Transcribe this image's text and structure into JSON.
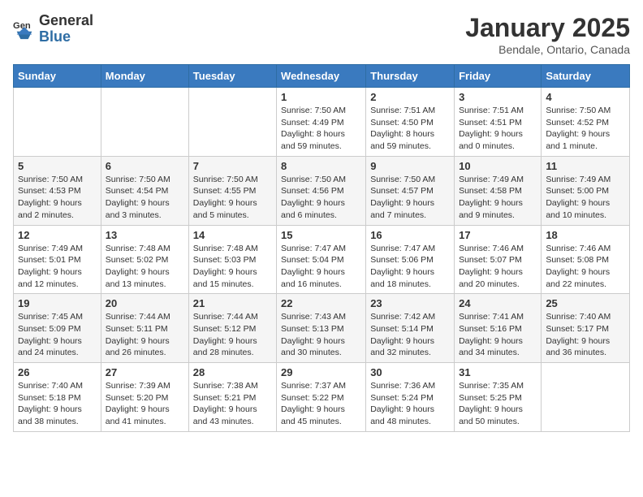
{
  "header": {
    "logo_general": "General",
    "logo_blue": "Blue",
    "month_title": "January 2025",
    "location": "Bendale, Ontario, Canada"
  },
  "weekdays": [
    "Sunday",
    "Monday",
    "Tuesday",
    "Wednesday",
    "Thursday",
    "Friday",
    "Saturday"
  ],
  "weeks": [
    [
      {
        "day": "",
        "info": ""
      },
      {
        "day": "",
        "info": ""
      },
      {
        "day": "",
        "info": ""
      },
      {
        "day": "1",
        "info": "Sunrise: 7:50 AM\nSunset: 4:49 PM\nDaylight: 8 hours\nand 59 minutes."
      },
      {
        "day": "2",
        "info": "Sunrise: 7:51 AM\nSunset: 4:50 PM\nDaylight: 8 hours\nand 59 minutes."
      },
      {
        "day": "3",
        "info": "Sunrise: 7:51 AM\nSunset: 4:51 PM\nDaylight: 9 hours\nand 0 minutes."
      },
      {
        "day": "4",
        "info": "Sunrise: 7:50 AM\nSunset: 4:52 PM\nDaylight: 9 hours\nand 1 minute."
      }
    ],
    [
      {
        "day": "5",
        "info": "Sunrise: 7:50 AM\nSunset: 4:53 PM\nDaylight: 9 hours\nand 2 minutes."
      },
      {
        "day": "6",
        "info": "Sunrise: 7:50 AM\nSunset: 4:54 PM\nDaylight: 9 hours\nand 3 minutes."
      },
      {
        "day": "7",
        "info": "Sunrise: 7:50 AM\nSunset: 4:55 PM\nDaylight: 9 hours\nand 5 minutes."
      },
      {
        "day": "8",
        "info": "Sunrise: 7:50 AM\nSunset: 4:56 PM\nDaylight: 9 hours\nand 6 minutes."
      },
      {
        "day": "9",
        "info": "Sunrise: 7:50 AM\nSunset: 4:57 PM\nDaylight: 9 hours\nand 7 minutes."
      },
      {
        "day": "10",
        "info": "Sunrise: 7:49 AM\nSunset: 4:58 PM\nDaylight: 9 hours\nand 9 minutes."
      },
      {
        "day": "11",
        "info": "Sunrise: 7:49 AM\nSunset: 5:00 PM\nDaylight: 9 hours\nand 10 minutes."
      }
    ],
    [
      {
        "day": "12",
        "info": "Sunrise: 7:49 AM\nSunset: 5:01 PM\nDaylight: 9 hours\nand 12 minutes."
      },
      {
        "day": "13",
        "info": "Sunrise: 7:48 AM\nSunset: 5:02 PM\nDaylight: 9 hours\nand 13 minutes."
      },
      {
        "day": "14",
        "info": "Sunrise: 7:48 AM\nSunset: 5:03 PM\nDaylight: 9 hours\nand 15 minutes."
      },
      {
        "day": "15",
        "info": "Sunrise: 7:47 AM\nSunset: 5:04 PM\nDaylight: 9 hours\nand 16 minutes."
      },
      {
        "day": "16",
        "info": "Sunrise: 7:47 AM\nSunset: 5:06 PM\nDaylight: 9 hours\nand 18 minutes."
      },
      {
        "day": "17",
        "info": "Sunrise: 7:46 AM\nSunset: 5:07 PM\nDaylight: 9 hours\nand 20 minutes."
      },
      {
        "day": "18",
        "info": "Sunrise: 7:46 AM\nSunset: 5:08 PM\nDaylight: 9 hours\nand 22 minutes."
      }
    ],
    [
      {
        "day": "19",
        "info": "Sunrise: 7:45 AM\nSunset: 5:09 PM\nDaylight: 9 hours\nand 24 minutes."
      },
      {
        "day": "20",
        "info": "Sunrise: 7:44 AM\nSunset: 5:11 PM\nDaylight: 9 hours\nand 26 minutes."
      },
      {
        "day": "21",
        "info": "Sunrise: 7:44 AM\nSunset: 5:12 PM\nDaylight: 9 hours\nand 28 minutes."
      },
      {
        "day": "22",
        "info": "Sunrise: 7:43 AM\nSunset: 5:13 PM\nDaylight: 9 hours\nand 30 minutes."
      },
      {
        "day": "23",
        "info": "Sunrise: 7:42 AM\nSunset: 5:14 PM\nDaylight: 9 hours\nand 32 minutes."
      },
      {
        "day": "24",
        "info": "Sunrise: 7:41 AM\nSunset: 5:16 PM\nDaylight: 9 hours\nand 34 minutes."
      },
      {
        "day": "25",
        "info": "Sunrise: 7:40 AM\nSunset: 5:17 PM\nDaylight: 9 hours\nand 36 minutes."
      }
    ],
    [
      {
        "day": "26",
        "info": "Sunrise: 7:40 AM\nSunset: 5:18 PM\nDaylight: 9 hours\nand 38 minutes."
      },
      {
        "day": "27",
        "info": "Sunrise: 7:39 AM\nSunset: 5:20 PM\nDaylight: 9 hours\nand 41 minutes."
      },
      {
        "day": "28",
        "info": "Sunrise: 7:38 AM\nSunset: 5:21 PM\nDaylight: 9 hours\nand 43 minutes."
      },
      {
        "day": "29",
        "info": "Sunrise: 7:37 AM\nSunset: 5:22 PM\nDaylight: 9 hours\nand 45 minutes."
      },
      {
        "day": "30",
        "info": "Sunrise: 7:36 AM\nSunset: 5:24 PM\nDaylight: 9 hours\nand 48 minutes."
      },
      {
        "day": "31",
        "info": "Sunrise: 7:35 AM\nSunset: 5:25 PM\nDaylight: 9 hours\nand 50 minutes."
      },
      {
        "day": "",
        "info": ""
      }
    ]
  ]
}
